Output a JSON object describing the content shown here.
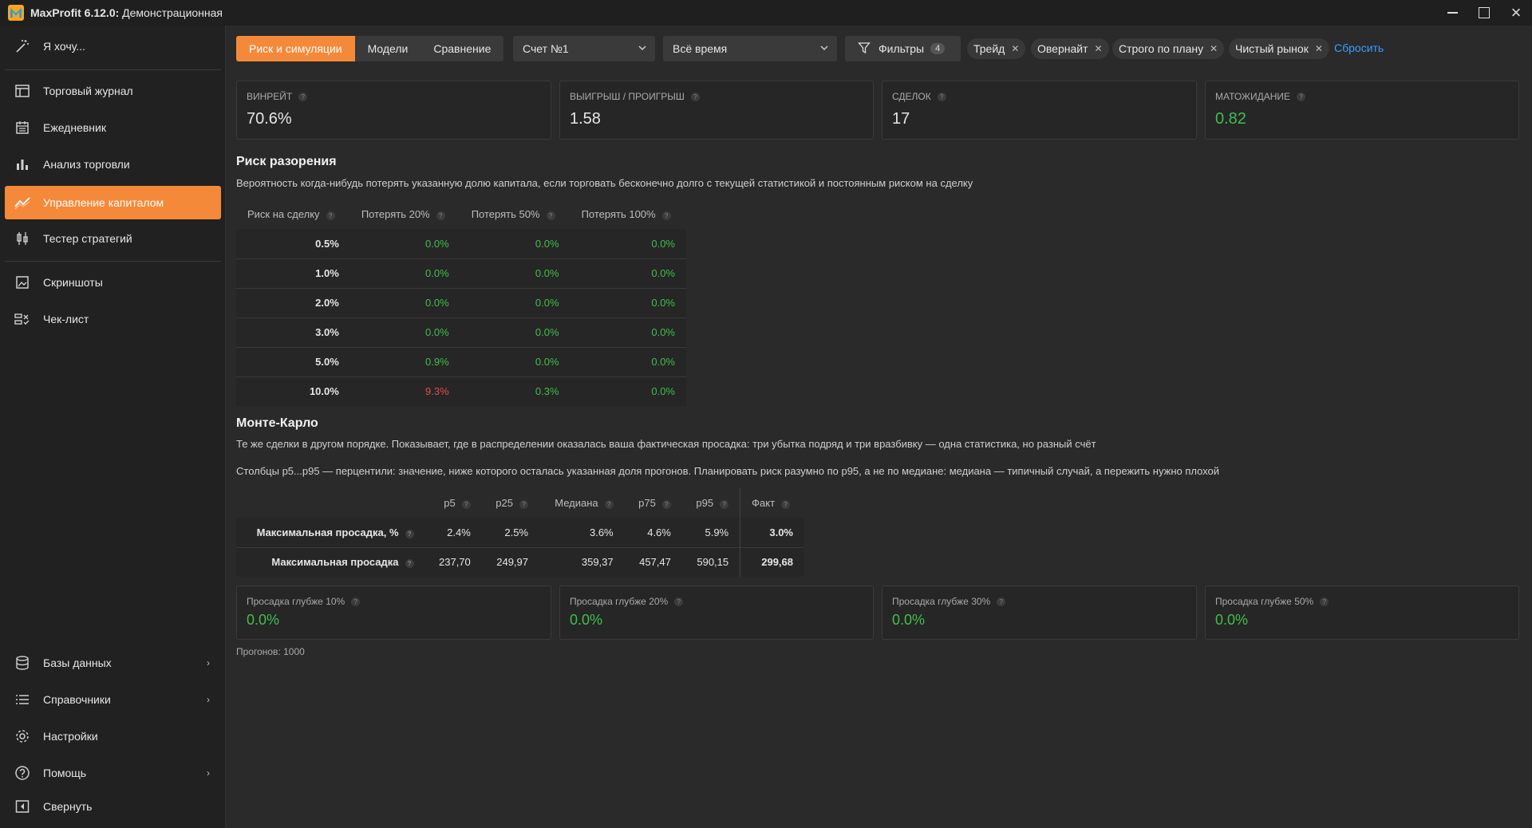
{
  "window": {
    "app_name": "MaxProfit 6.12.0:",
    "subtitle": "Демонстрационная"
  },
  "sidebar": {
    "top_item": {
      "label": "Я хочу...",
      "icon": "magic-wand-icon"
    },
    "items": [
      {
        "label": "Торговый журнал",
        "icon": "table-icon"
      },
      {
        "label": "Ежедневник",
        "icon": "calendar-icon"
      },
      {
        "label": "Анализ торговли",
        "icon": "bar-chart-icon"
      },
      {
        "label": "Управление капиталом",
        "icon": "trend-icon",
        "active": true
      },
      {
        "label": "Тестер стратегий",
        "icon": "candles-icon"
      },
      {
        "label": "Скриншоты",
        "icon": "image-icon"
      },
      {
        "label": "Чек-лист",
        "icon": "checklist-icon"
      }
    ],
    "bottom_items": [
      {
        "label": "Базы данных",
        "icon": "database-icon",
        "has_submenu": true
      },
      {
        "label": "Справочники",
        "icon": "list-icon",
        "has_submenu": true
      },
      {
        "label": "Настройки",
        "icon": "gear-icon",
        "has_submenu": false
      },
      {
        "label": "Помощь",
        "icon": "help-icon",
        "has_submenu": true
      },
      {
        "label": "Свернуть",
        "icon": "collapse-icon",
        "has_submenu": false
      }
    ]
  },
  "toolbar": {
    "tabs": [
      "Риск и симуляции",
      "Модели",
      "Сравнение"
    ],
    "active_tab": "Риск и симуляции",
    "account": "Счет №1",
    "period": "Всё время",
    "filters_label": "Фильтры",
    "filters_count": "4",
    "chips": [
      "Трейд",
      "Овернайт",
      "Строго по плану",
      "Чистый рынок"
    ],
    "reset_label": "Сбросить"
  },
  "stats": [
    {
      "label": "ВИНРЕЙТ",
      "value": "70.6%",
      "color": "#e6e6e6"
    },
    {
      "label": "ВЫИГРЫШ / ПРОИГРЫШ",
      "value": "1.58",
      "color": "#e6e6e6"
    },
    {
      "label": "СДЕЛОК",
      "value": "17",
      "color": "#e6e6e6"
    },
    {
      "label": "МАТОЖИДАНИЕ",
      "value": "0.82",
      "color": "#3fbf4a"
    }
  ],
  "ruin": {
    "title": "Риск разорения",
    "description": "Вероятность когда-нибудь потерять указанную долю капитала, если торговать бесконечно долго с текущей статистикой и постоянным риском на сделку",
    "headers": [
      "Риск на сделку",
      "Потерять 20%",
      "Потерять 50%",
      "Потерять 100%"
    ],
    "rows": [
      {
        "risk": "0.5%",
        "values": [
          "0.0%",
          "0.0%",
          "0.0%"
        ],
        "colors": [
          "green",
          "green",
          "green"
        ]
      },
      {
        "risk": "1.0%",
        "values": [
          "0.0%",
          "0.0%",
          "0.0%"
        ],
        "colors": [
          "green",
          "green",
          "green"
        ]
      },
      {
        "risk": "2.0%",
        "values": [
          "0.0%",
          "0.0%",
          "0.0%"
        ],
        "colors": [
          "green",
          "green",
          "green"
        ]
      },
      {
        "risk": "3.0%",
        "values": [
          "0.0%",
          "0.0%",
          "0.0%"
        ],
        "colors": [
          "green",
          "green",
          "green"
        ]
      },
      {
        "risk": "5.0%",
        "values": [
          "0.9%",
          "0.0%",
          "0.0%"
        ],
        "colors": [
          "green",
          "green",
          "green"
        ]
      },
      {
        "risk": "10.0%",
        "values": [
          "9.3%",
          "0.3%",
          "0.0%"
        ],
        "colors": [
          "red",
          "green",
          "green"
        ]
      }
    ]
  },
  "monte_carlo": {
    "title": "Монте-Карло",
    "description1": "Те же сделки в другом порядке. Показывает, где в распределении оказалась ваша фактическая просадка: три убытка подряд и три вразбивку — одна статистика, но разный счёт",
    "description2": "Столбцы р5...р95 — перцентили: значение, ниже которого осталась указанная доля прогонов. Планировать риск разумно по р95, а не по медиане: медиана — типичный случай, а пережить нужно плохой",
    "headers": [
      "р5",
      "р25",
      "Медиана",
      "р75",
      "р95",
      "Факт"
    ],
    "rows": [
      {
        "label": "Максимальная просадка, %",
        "values": [
          "2.4%",
          "2.5%",
          "3.6%",
          "4.6%",
          "5.9%"
        ],
        "fact": "3.0%"
      },
      {
        "label": "Максимальная просадка",
        "values": [
          "237,70",
          "249,97",
          "359,37",
          "457,47",
          "590,15"
        ],
        "fact": "299,68"
      }
    ]
  },
  "drawdown_cards": [
    {
      "label": "Просадка глубже 10%",
      "value": "0.0%"
    },
    {
      "label": "Просадка глубже 20%",
      "value": "0.0%"
    },
    {
      "label": "Просадка глубже 30%",
      "value": "0.0%"
    },
    {
      "label": "Просадка глубже 50%",
      "value": "0.0%"
    }
  ],
  "footnote": "Прогонов: 1000",
  "colors": {
    "accent": "#f5893a",
    "positive": "#3fbf4a",
    "negative": "#e04b4b",
    "link": "#3b9cff"
  }
}
